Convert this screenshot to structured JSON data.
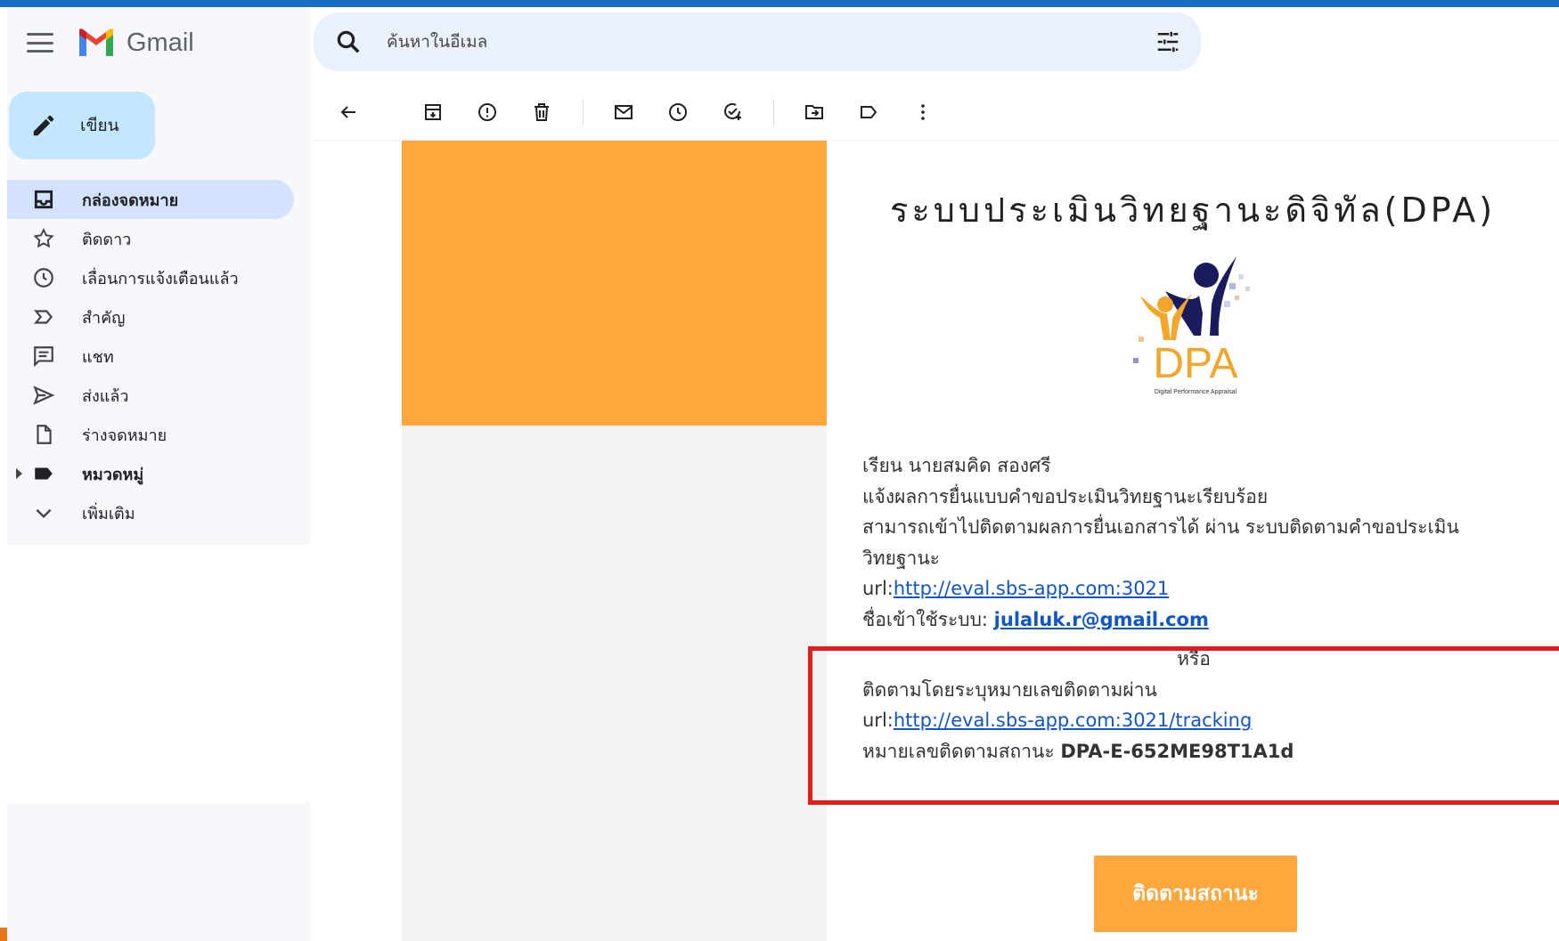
{
  "app": {
    "name": "Gmail"
  },
  "compose": {
    "label": "เขียน"
  },
  "sidebar": {
    "items": [
      {
        "label": "กล่องจดหมาย",
        "icon": "inbox-icon",
        "active": true
      },
      {
        "label": "ติดดาว",
        "icon": "star-icon"
      },
      {
        "label": "เลื่อนการแจ้งเตือนแล้ว",
        "icon": "clock-icon"
      },
      {
        "label": "สำคัญ",
        "icon": "important-icon"
      },
      {
        "label": "แชท",
        "icon": "chat-icon"
      },
      {
        "label": "ส่งแล้ว",
        "icon": "send-icon"
      },
      {
        "label": "ร่างจดหมาย",
        "icon": "draft-icon"
      },
      {
        "label": "หมวดหมู่",
        "icon": "label-icon"
      },
      {
        "label": "เพิ่มเติม",
        "icon": "chevron-down-icon"
      }
    ]
  },
  "search": {
    "placeholder": "ค้นหาในอีเมล"
  },
  "toolbar": {
    "icons": [
      "back-arrow-icon",
      "archive-icon",
      "report-spam-icon",
      "delete-icon",
      "mark-unread-icon",
      "snooze-icon",
      "add-task-icon",
      "move-to-icon",
      "label-icon",
      "more-icon"
    ]
  },
  "email": {
    "title": "ระบบประเมินวิทยฐานะดิจิทัล(DPA)",
    "logo_text": "DPA",
    "logo_sub": "Digital Performance Appraisal",
    "greeting": "เรียน นายสมคิด สองศรี",
    "line1": "แจ้งผลการยื่นแบบคำขอประเมินวิทยฐานะเรียบร้อย",
    "line2a": "สามารถเข้าไปติดตามผลการยื่นเอกสารได้ ผ่าน ระบบติดตามคำขอประเมิน",
    "line2b": "วิทยฐานะ",
    "url_prefix": "url:",
    "url1": "http://eval.sbs-app.com:3021",
    "login_label": "ชื่อเข้าใช้ระบบ: ",
    "login_email": "julaluk.r@gmail.com",
    "or": "หรือ",
    "track_text": "ติดตามโดยระบุหมายเลขติดตามผ่าน",
    "url2": "http://eval.sbs-app.com:3021/tracking",
    "tracking_label": "หมายเลขติดตามสถานะ ",
    "tracking_code": "DPA-E-652ME98T1A1d",
    "button_label": "ติดตามสถานะ"
  },
  "colors": {
    "accent_orange": "#ffa63c",
    "highlight_red": "#e21b1b",
    "link_blue": "#1155cc",
    "compose_blue": "#c2e7ff",
    "active_nav": "#d3e3fd"
  }
}
